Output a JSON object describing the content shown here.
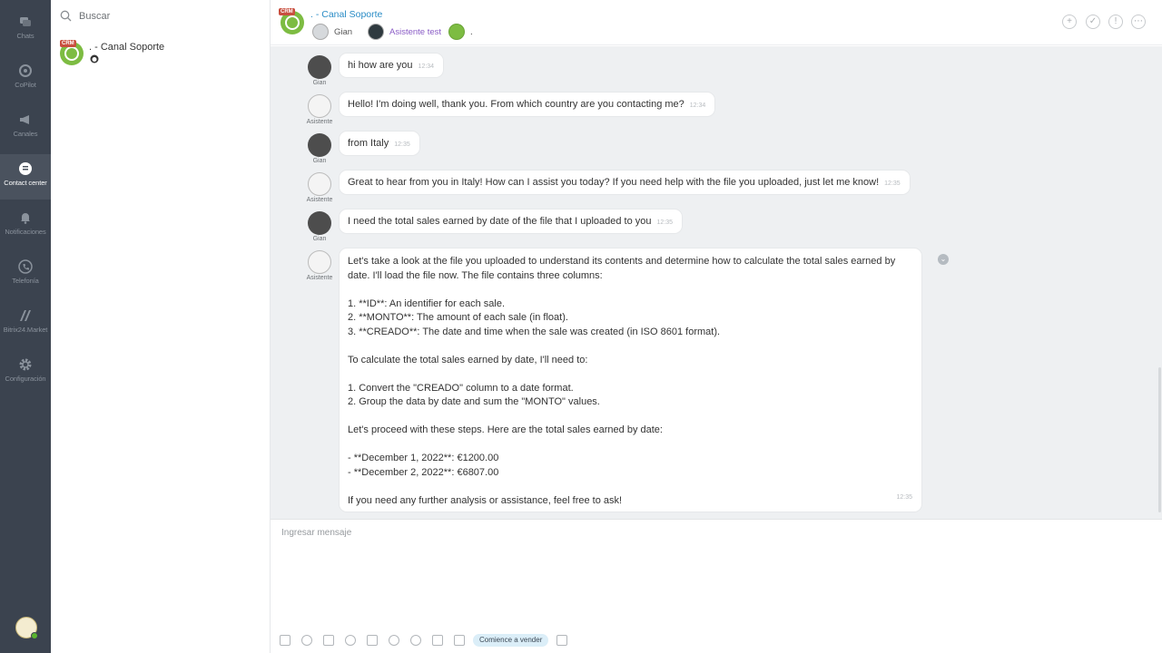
{
  "nav": {
    "items": [
      {
        "label": "Chats",
        "icon": "chats-icon"
      },
      {
        "label": "CoPilot",
        "icon": "copilot-icon"
      },
      {
        "label": "Canales",
        "icon": "megaphone-icon"
      },
      {
        "label": "Contact center",
        "icon": "contact-center-icon"
      },
      {
        "label": "Notificaciones",
        "icon": "bell-icon"
      },
      {
        "label": "Telefonía",
        "icon": "phone-icon"
      },
      {
        "label": "Bitrix24.Market",
        "icon": "market-icon"
      },
      {
        "label": "Configuración",
        "icon": "gear-icon"
      }
    ],
    "active_index": 3
  },
  "chat_list": {
    "search_placeholder": "Buscar",
    "items": [
      {
        "title": ". - Canal Soporte",
        "badge": "CRM"
      }
    ]
  },
  "header": {
    "badge": "CRM",
    "title": ". - Canal Soporte",
    "members": [
      {
        "name": "Gian"
      },
      {
        "name": "Asistente test"
      },
      {
        "name": "."
      }
    ],
    "buttons": [
      "add-icon",
      "check-icon",
      "info-icon",
      "more-icon"
    ]
  },
  "messages": [
    {
      "author": "Gian",
      "text": "hi how are you",
      "time": "12:34"
    },
    {
      "author": "Asistente",
      "text": "Hello! I'm doing well, thank you. From which country are you contacting me?",
      "time": "12:34"
    },
    {
      "author": "Gian",
      "text": "from Italy",
      "time": "12:35"
    },
    {
      "author": "Asistente",
      "text": "Great to hear from you in Italy! How can I assist you today? If you need help with the file you uploaded, just let me know!",
      "time": "12:35"
    },
    {
      "author": "Gian",
      "text": "I need the total sales earned by date of the file that I uploaded to you",
      "time": "12:35"
    }
  ],
  "long_message": {
    "author": "Asistente",
    "time": "12:35",
    "paragraphs": [
      [
        "Let's take a look at the file you uploaded to understand its contents and determine how to calculate the total sales earned by date. I'll load the file now. The file contains three columns:"
      ],
      [
        "1. **ID**: An identifier for each sale.",
        "2. **MONTO**: The amount of each sale (in float).",
        "3. **CREADO**: The date and time when the sale was created (in ISO 8601 format)."
      ],
      [
        "To calculate the total sales earned by date, I'll need to:"
      ],
      [
        "1. Convert the \"CREADO\" column to a date format.",
        "2. Group the data by date and sum the \"MONTO\" values."
      ],
      [
        "Let's proceed with these steps. Here are the total sales earned by date:"
      ],
      [
        "- **December 1, 2022**: €1200.00",
        "- **December 2, 2022**: €6807.00"
      ],
      [
        "If you need any further analysis or assistance, feel free to ask!"
      ]
    ]
  },
  "composer": {
    "placeholder": "Ingresar mensaje",
    "sell_button": "Comience a vender"
  },
  "colors": {
    "accent": "#2a8cc6",
    "crm_green": "#7dbc42",
    "crm_badge": "#c94f3f",
    "nav_bg": "#3b434f"
  }
}
